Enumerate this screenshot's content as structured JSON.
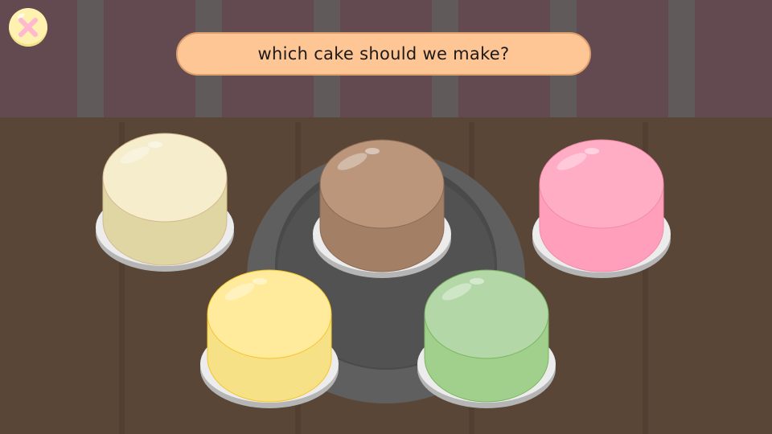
{
  "header": {
    "prompt": "which cake should we make?"
  },
  "colors": {
    "wall": "#634a50",
    "wall_stripe": "#615a5b",
    "floor": "#5a4636",
    "floor_line": "#4f3d2f",
    "banner": "#fec595",
    "close_button": "#fff1b0",
    "close_x": "#ffb8cf"
  },
  "cakes": [
    {
      "top": "#f5edcb",
      "side": "#e0d6a4",
      "outline": "#d6b98f"
    },
    {
      "top": "#bb967b",
      "side": "#a27f65",
      "outline": "#8d6b54"
    },
    {
      "top": "#ffadc5",
      "side": "#ff9fbb",
      "outline": "#f28aa8"
    },
    {
      "top": "#ffeb9b",
      "side": "#f7e187",
      "outline": "#f5c52b"
    },
    {
      "top": "#b4d7a8",
      "side": "#a1d08c",
      "outline": "#7ab660"
    }
  ]
}
